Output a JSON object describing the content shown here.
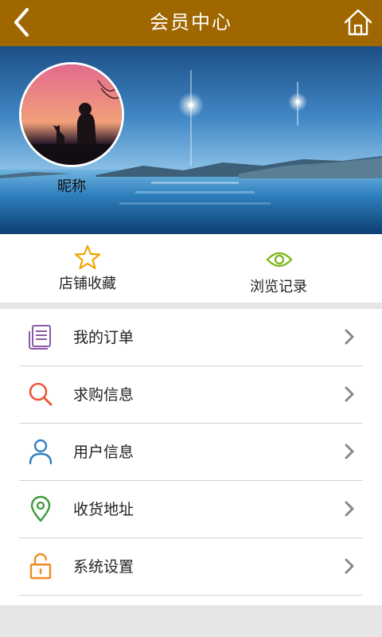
{
  "header": {
    "title": "会员中心",
    "back_icon": "back-chevron-icon",
    "home_icon": "home-icon",
    "bg": "#a06700"
  },
  "profile": {
    "nickname": "昵称"
  },
  "quick_actions": [
    {
      "label": "店铺收藏",
      "icon": "star-icon",
      "color": "#f0a500"
    },
    {
      "label": "浏览记录",
      "icon": "eye-icon",
      "color": "#7cb518"
    }
  ],
  "menu": [
    {
      "label": "我的订单",
      "icon": "order-document-icon",
      "color": "#8a5aa8"
    },
    {
      "label": "求购信息",
      "icon": "search-icon",
      "color": "#e8583a"
    },
    {
      "label": "用户信息",
      "icon": "user-icon",
      "color": "#2f7fc1"
    },
    {
      "label": "收货地址",
      "icon": "location-pin-icon",
      "color": "#3a9a3a"
    },
    {
      "label": "系统设置",
      "icon": "unlock-icon",
      "color": "#f08a24"
    }
  ]
}
